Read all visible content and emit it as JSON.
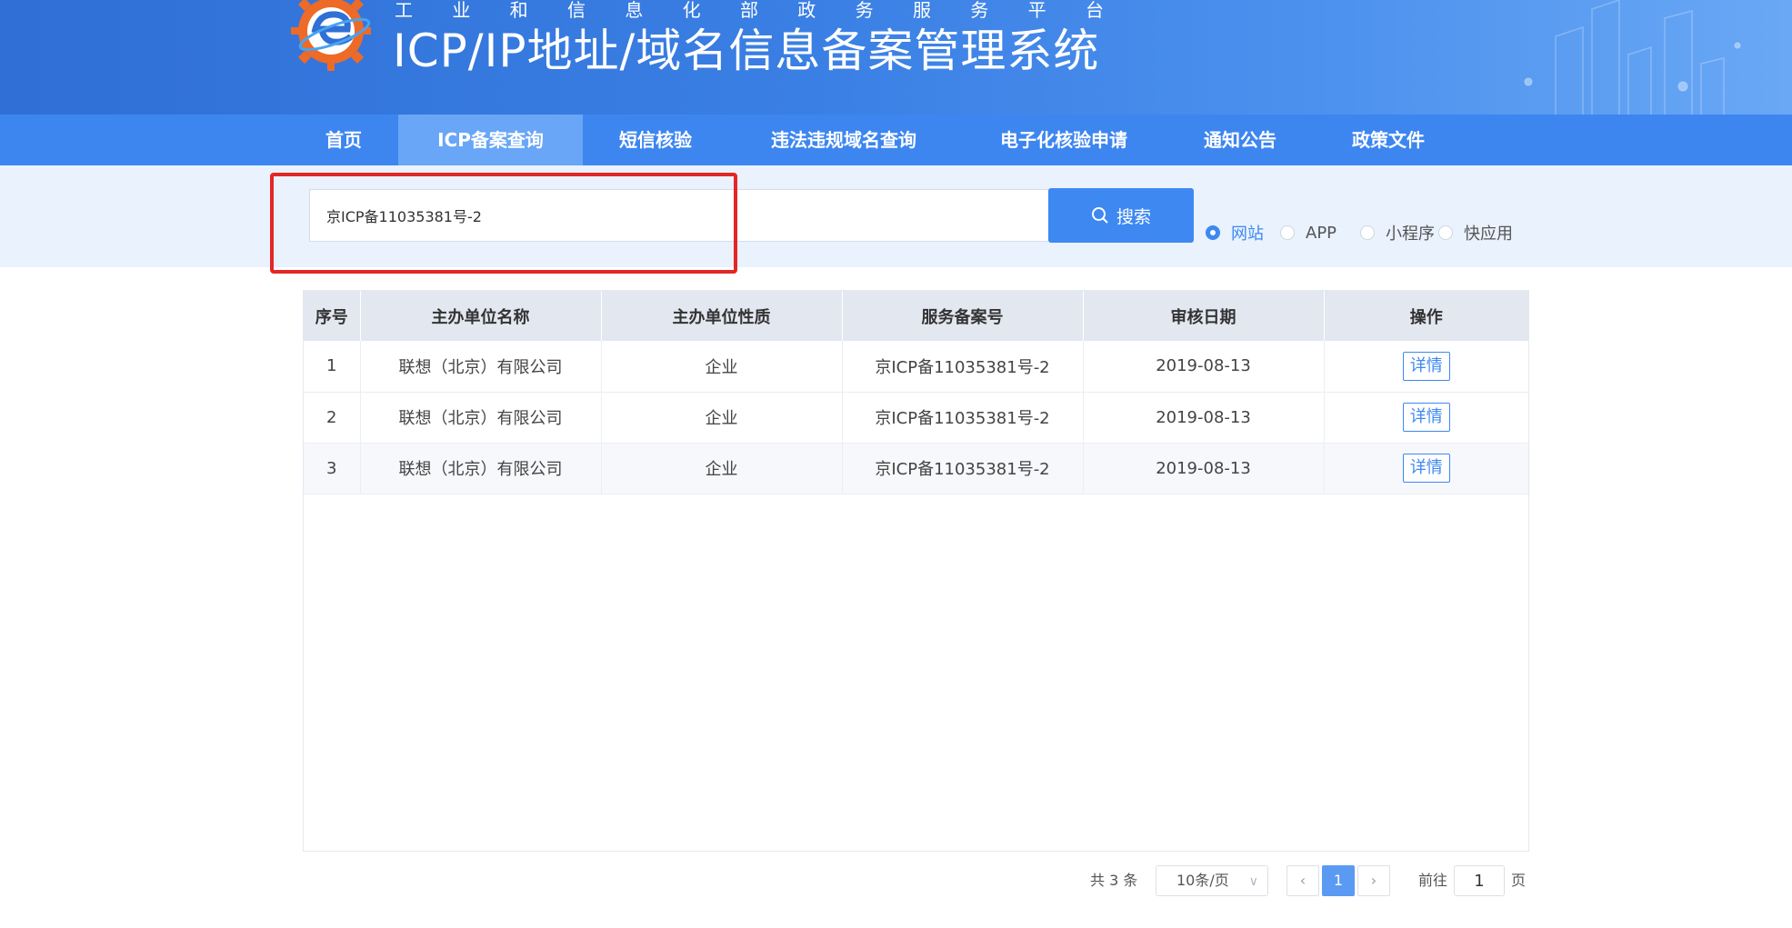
{
  "header": {
    "subtitle_chars": [
      "工",
      "业",
      "和",
      "信",
      "息",
      "化",
      "部",
      "政",
      "务",
      "服",
      "务",
      "平",
      "台"
    ],
    "title": "ICP/IP地址/域名信息备案管理系统"
  },
  "nav": {
    "items": [
      {
        "label": "首页"
      },
      {
        "label": "ICP备案查询",
        "active": true
      },
      {
        "label": "短信核验"
      },
      {
        "label": "违法违规域名查询"
      },
      {
        "label": "电子化核验申请"
      },
      {
        "label": "通知公告"
      },
      {
        "label": "政策文件"
      }
    ]
  },
  "search": {
    "value": "京ICP备11035381号-2",
    "button_label": "搜索",
    "options": [
      {
        "label": "网站",
        "checked": true
      },
      {
        "label": "APP",
        "checked": false
      },
      {
        "label": "小程序",
        "checked": false
      },
      {
        "label": "快应用",
        "checked": false
      }
    ]
  },
  "table": {
    "headers": [
      "序号",
      "主办单位名称",
      "主办单位性质",
      "服务备案号",
      "审核日期",
      "操作"
    ],
    "rows": [
      {
        "index": "1",
        "name": "联想（北京）有限公司",
        "type": "企业",
        "record": "京ICP备11035381号-2",
        "date": "2019-08-13",
        "action": "详情"
      },
      {
        "index": "2",
        "name": "联想（北京）有限公司",
        "type": "企业",
        "record": "京ICP备11035381号-2",
        "date": "2019-08-13",
        "action": "详情"
      },
      {
        "index": "3",
        "name": "联想（北京）有限公司",
        "type": "企业",
        "record": "京ICP备11035381号-2",
        "date": "2019-08-13",
        "action": "详情"
      }
    ]
  },
  "pagination": {
    "total": "共 3 条",
    "page_size": "10条/页",
    "prev": "‹",
    "current": "1",
    "next": "›",
    "goto_prefix": "前往",
    "goto_value": "1",
    "goto_suffix": "页"
  },
  "colors": {
    "primary": "#3e88f2",
    "nav_bg": "#3d86f0",
    "highlight": "#e32626"
  }
}
